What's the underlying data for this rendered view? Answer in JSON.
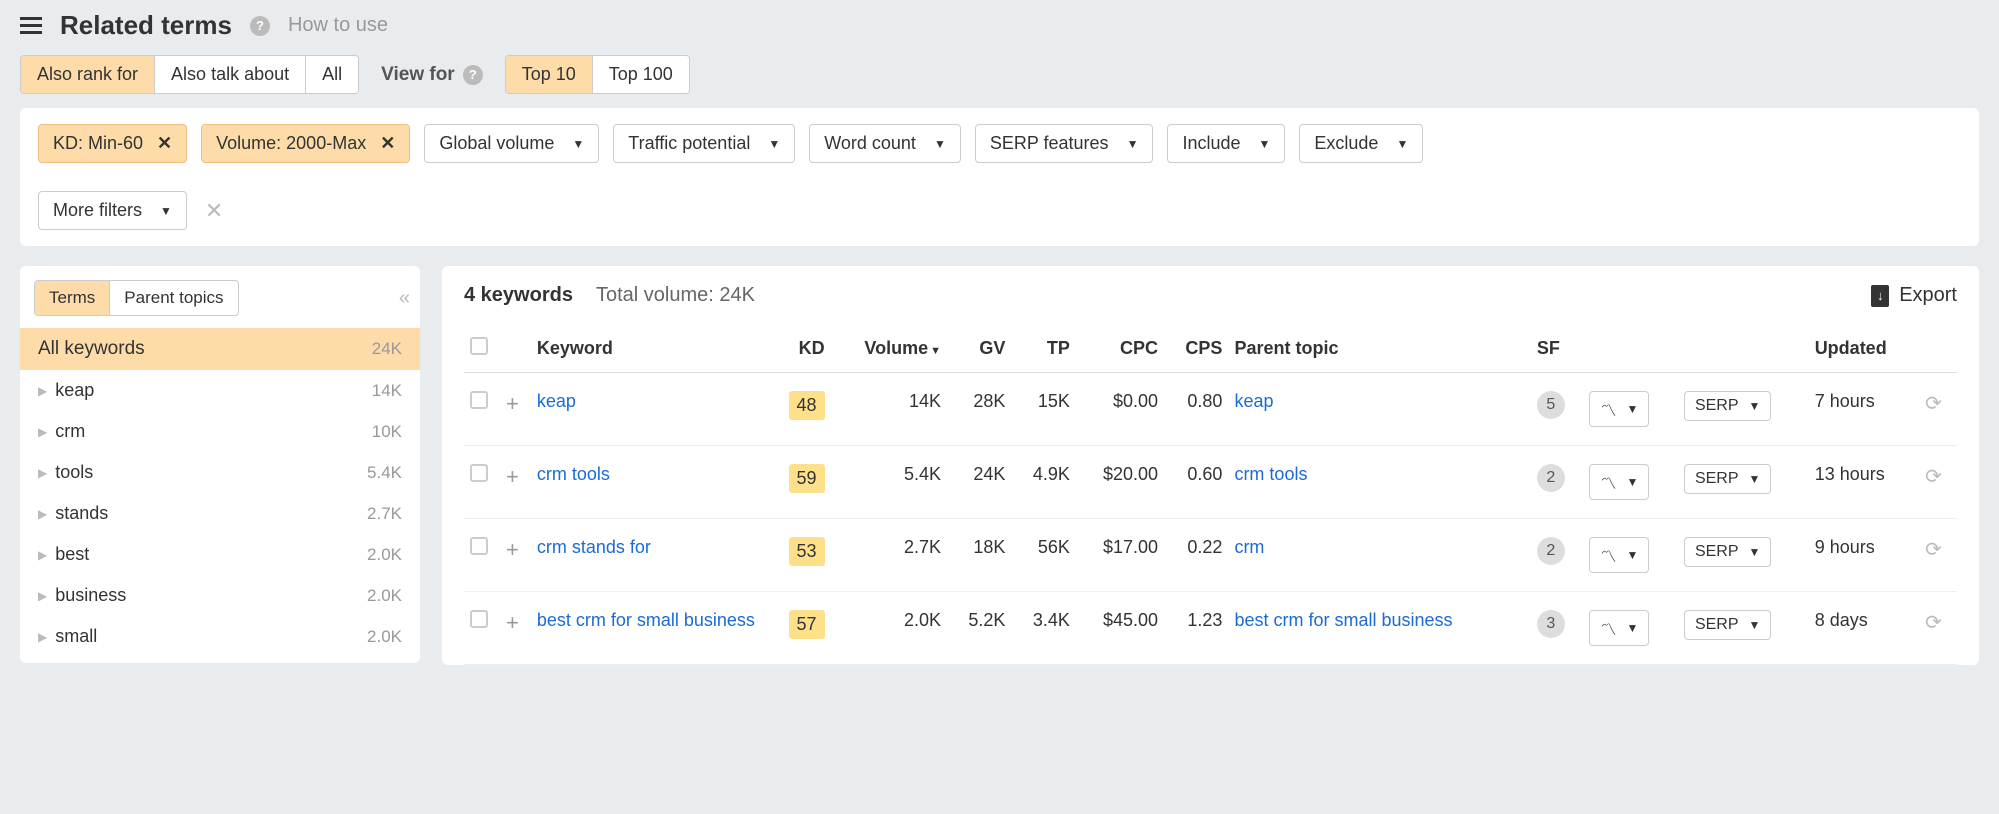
{
  "header": {
    "title": "Related terms",
    "how_to_use": "How to use"
  },
  "mode_tabs": {
    "also_rank_for": "Also rank for",
    "also_talk_about": "Also talk about",
    "all": "All"
  },
  "view_for": {
    "label": "View for",
    "top10": "Top 10",
    "top100": "Top 100"
  },
  "filters": {
    "kd": "KD: Min-60",
    "volume": "Volume: 2000-Max",
    "global_volume": "Global volume",
    "traffic_potential": "Traffic potential",
    "word_count": "Word count",
    "serp_features": "SERP features",
    "include": "Include",
    "exclude": "Exclude",
    "more_filters": "More filters"
  },
  "sidebar": {
    "tabs": {
      "terms": "Terms",
      "parent_topics": "Parent topics"
    },
    "all_keywords_label": "All keywords",
    "all_keywords_count": "24K",
    "items": [
      {
        "label": "keap",
        "count": "14K"
      },
      {
        "label": "crm",
        "count": "10K"
      },
      {
        "label": "tools",
        "count": "5.4K"
      },
      {
        "label": "stands",
        "count": "2.7K"
      },
      {
        "label": "best",
        "count": "2.0K"
      },
      {
        "label": "business",
        "count": "2.0K"
      },
      {
        "label": "small",
        "count": "2.0K"
      }
    ]
  },
  "content": {
    "keyword_count": "4 keywords",
    "total_volume": "Total volume: 24K",
    "export": "Export",
    "columns": {
      "keyword": "Keyword",
      "kd": "KD",
      "volume": "Volume",
      "gv": "GV",
      "tp": "TP",
      "cpc": "CPC",
      "cps": "CPS",
      "parent_topic": "Parent topic",
      "sf": "SF",
      "updated": "Updated"
    },
    "serp_btn": "SERP",
    "rows": [
      {
        "keyword": "keap",
        "kd": "48",
        "volume": "14K",
        "gv": "28K",
        "tp": "15K",
        "cpc": "$0.00",
        "cps": "0.80",
        "parent": "keap",
        "sf": "5",
        "updated": "7 hours"
      },
      {
        "keyword": "crm tools",
        "kd": "59",
        "volume": "5.4K",
        "gv": "24K",
        "tp": "4.9K",
        "cpc": "$20.00",
        "cps": "0.60",
        "parent": "crm tools",
        "sf": "2",
        "updated": "13 hours"
      },
      {
        "keyword": "crm stands for",
        "kd": "53",
        "volume": "2.7K",
        "gv": "18K",
        "tp": "56K",
        "cpc": "$17.00",
        "cps": "0.22",
        "parent": "crm",
        "sf": "2",
        "updated": "9 hours"
      },
      {
        "keyword": "best crm for small business",
        "kd": "57",
        "volume": "2.0K",
        "gv": "5.2K",
        "tp": "3.4K",
        "cpc": "$45.00",
        "cps": "1.23",
        "parent": "best crm for small business",
        "sf": "3",
        "updated": "8 days"
      }
    ]
  }
}
